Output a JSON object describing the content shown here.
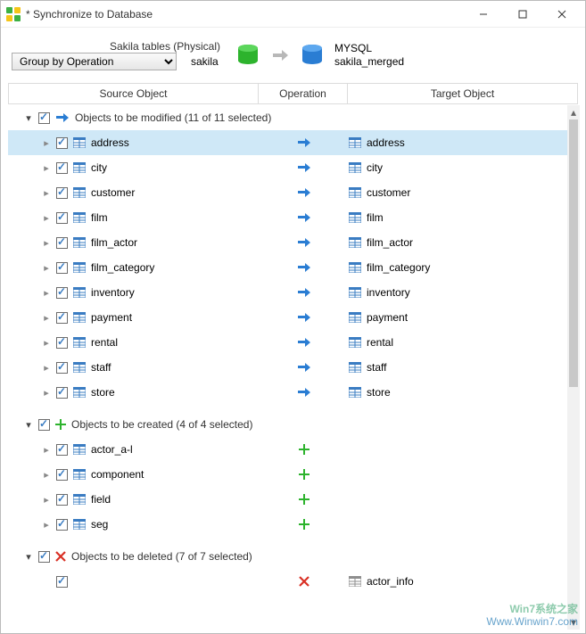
{
  "window": {
    "title": "* Synchronize to Database"
  },
  "header": {
    "source_label": "Sakila tables (Physical)",
    "source_db": "sakila",
    "target_engine": "MYSQL",
    "target_db": "sakila_merged",
    "group_selected": "Group by Operation"
  },
  "columns": {
    "source": "Source Object",
    "operation": "Operation",
    "target": "Target Object"
  },
  "groups": {
    "modify": {
      "label": "Objects to be modified (11 of 11 selected)",
      "items": [
        {
          "src": "address",
          "tgt": "address"
        },
        {
          "src": "city",
          "tgt": "city"
        },
        {
          "src": "customer",
          "tgt": "customer"
        },
        {
          "src": "film",
          "tgt": "film"
        },
        {
          "src": "film_actor",
          "tgt": "film_actor"
        },
        {
          "src": "film_category",
          "tgt": "film_category"
        },
        {
          "src": "inventory",
          "tgt": "inventory"
        },
        {
          "src": "payment",
          "tgt": "payment"
        },
        {
          "src": "rental",
          "tgt": "rental"
        },
        {
          "src": "staff",
          "tgt": "staff"
        },
        {
          "src": "store",
          "tgt": "store"
        }
      ]
    },
    "create": {
      "label": "Objects to be created (4 of 4 selected)",
      "items": [
        {
          "src": "actor_a-l"
        },
        {
          "src": "component"
        },
        {
          "src": "field"
        },
        {
          "src": "seg"
        }
      ]
    },
    "delete": {
      "label": "Objects to be deleted (7 of 7 selected)",
      "items": [
        {
          "tgt": "actor_info"
        }
      ]
    }
  },
  "watermark": {
    "line1": "Win7系统之家",
    "line2": "Www.Winwin7.com"
  }
}
